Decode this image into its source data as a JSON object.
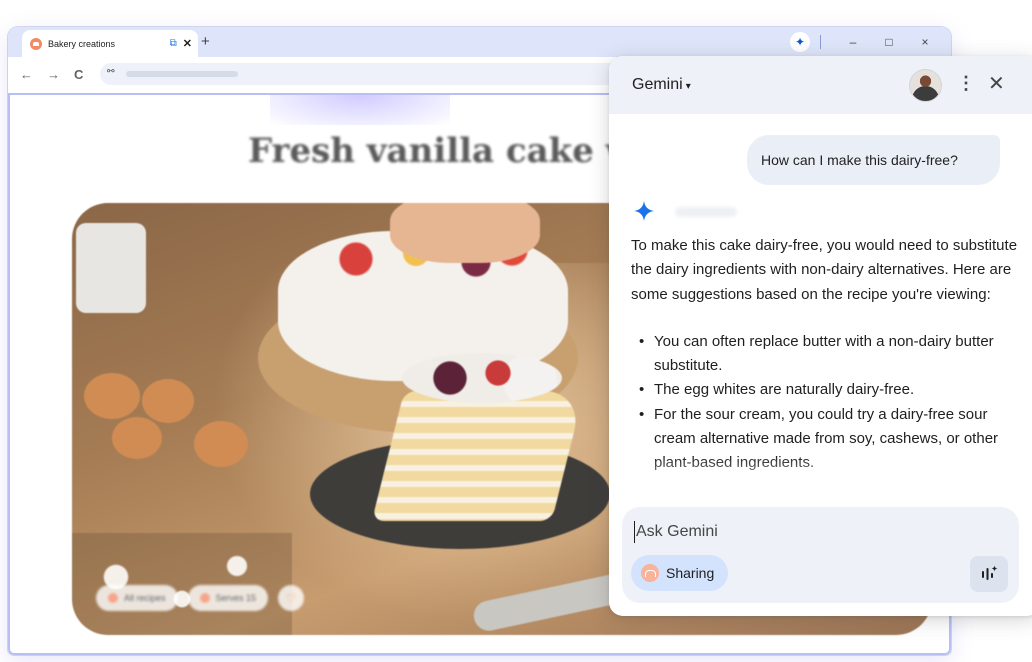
{
  "browser": {
    "tab": {
      "title": "Bakery creations",
      "favicon": "cake-favicon-icon"
    },
    "new_tab_label": "+",
    "window_controls": {
      "minimize": "–",
      "maximize": "□",
      "close": "×"
    },
    "nav": {
      "back": "←",
      "forward": "→",
      "reload": "C"
    }
  },
  "page": {
    "title": "Fresh vanilla cake with f",
    "chips": [
      "All recipes",
      "Serves 15"
    ]
  },
  "gemini": {
    "title": "Gemini",
    "user_message": "How can I make this dairy-free?",
    "response_intro": "To make this cake dairy-free, you would need to substitute the dairy ingredients with non-dairy alternatives. Here are some suggestions based on the recipe you're viewing:",
    "suggestions": [
      "You can often replace butter with a non-dairy butter substitute.",
      "The egg whites are naturally dairy-free.",
      "For the sour cream, you could try a dairy-free sour cream alternative made from soy, cashews, or other plant-based ingredients."
    ],
    "input_placeholder": "Ask Gemini",
    "sharing_label": "Sharing",
    "colors": {
      "accent": "#1a73e8",
      "header_bg": "#eef1f8",
      "chip_bg": "#d3e3fd"
    }
  }
}
